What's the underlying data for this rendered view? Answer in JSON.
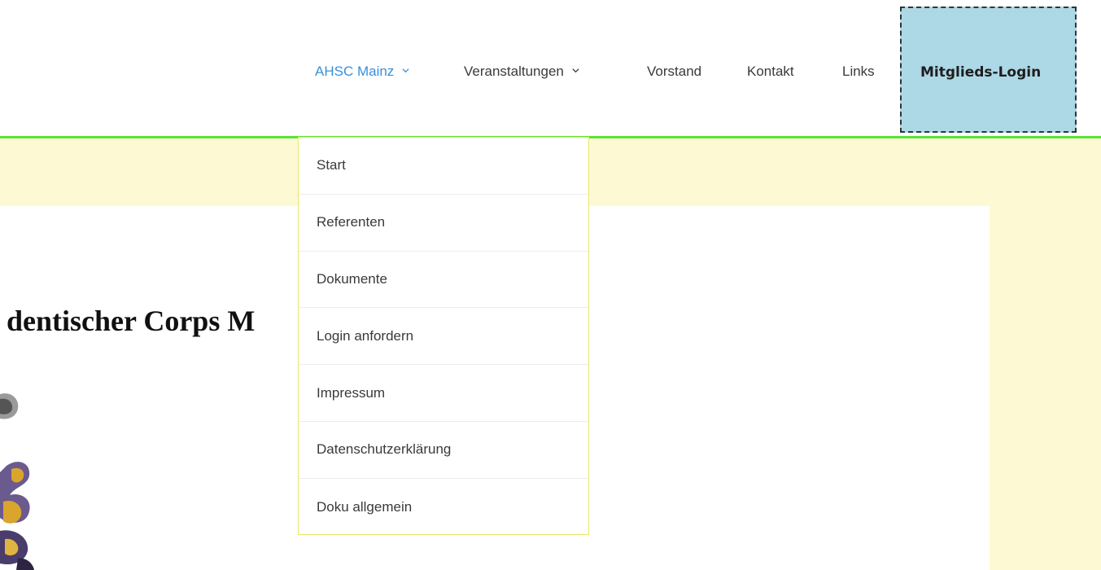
{
  "nav": {
    "items": [
      {
        "label": "AHSC Mainz",
        "has_dropdown": true,
        "active": true
      },
      {
        "label": "Veranstaltungen",
        "has_dropdown": true,
        "active": false
      },
      {
        "label": "Vorstand",
        "has_dropdown": false,
        "active": false
      },
      {
        "label": "Kontakt",
        "has_dropdown": false,
        "active": false
      },
      {
        "label": "Links",
        "has_dropdown": false,
        "active": false
      }
    ],
    "login_label": "Mitglieds-Login"
  },
  "dropdown": {
    "items": [
      {
        "label": "Start"
      },
      {
        "label": "Referenten"
      },
      {
        "label": "Dokumente"
      },
      {
        "label": "Login anfordern"
      },
      {
        "label": "Impressum"
      },
      {
        "label": "Datenschutzerklärung"
      },
      {
        "label": "Doku allgemein"
      }
    ]
  },
  "main": {
    "heading": "dentischer Corps M"
  },
  "colors": {
    "accent": "#3a8fd9",
    "login_bg": "#add8e6",
    "header_line": "#5ae23a",
    "content_bg": "#fdf9d3",
    "dropdown_border": "#e7e86a"
  },
  "icons": {
    "dropdown_indicator": "chevron-down-icon",
    "crest": "crest-icon"
  }
}
